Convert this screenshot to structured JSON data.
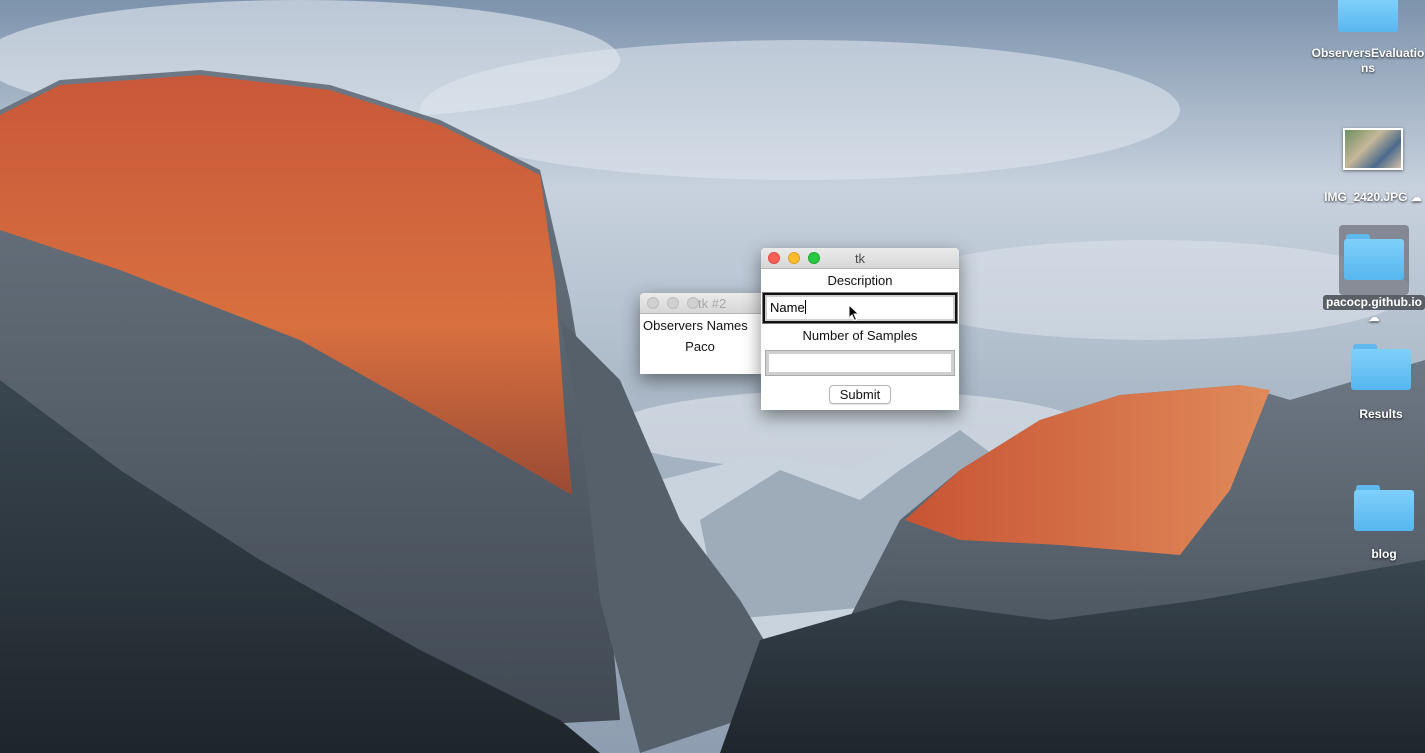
{
  "desktop": {
    "icons": [
      {
        "label": "ObserversEvaluations",
        "kind": "folder"
      },
      {
        "label": "IMG_2420.JPG",
        "kind": "image"
      },
      {
        "label": "pacocp.github.io",
        "kind": "folder",
        "selected": true
      },
      {
        "label": "Results",
        "kind": "folder"
      },
      {
        "label": "blog",
        "kind": "folder"
      }
    ],
    "colors": {
      "folder": "#6cc4f7",
      "sky": "#b8c5d4",
      "cliff_glow": "#d9683a"
    }
  },
  "main_window": {
    "title": "tk",
    "description_label": "Description",
    "name_entry_value": "Name",
    "samples_label": "Number of Samples",
    "samples_entry_value": "",
    "submit_label": "Submit",
    "traffic_lights": [
      "close-icon",
      "minimize-icon",
      "zoom-icon"
    ],
    "colors": {
      "close": "#fc5f57",
      "minimize": "#fdbc2e",
      "zoom": "#28c840"
    }
  },
  "secondary_window": {
    "title": "tk #2",
    "header_label": "Observers Names",
    "names": [
      "Paco"
    ]
  }
}
